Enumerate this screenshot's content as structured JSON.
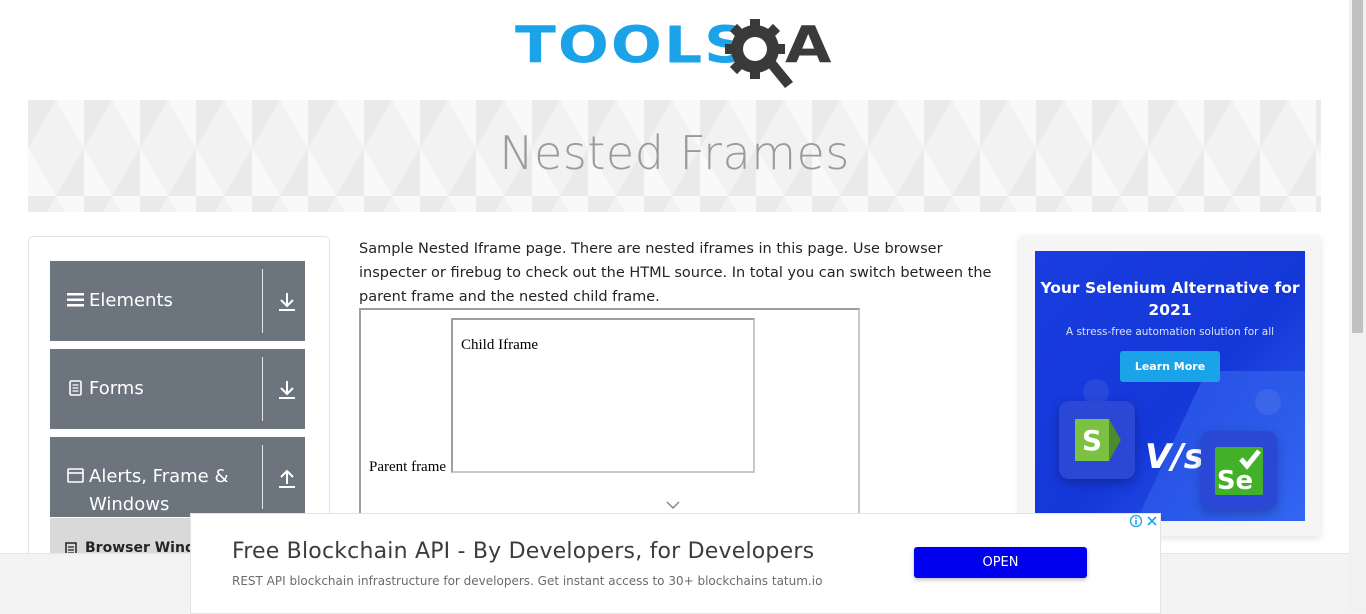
{
  "header": {
    "logo_tools": "TOOLS",
    "logo_a": "A",
    "logo_colors": {
      "tools": "#1aa3e8",
      "qa": "#3a3a3a"
    }
  },
  "banner": {
    "title": "Nested Frames"
  },
  "sidebar": {
    "groups": [
      {
        "label": "Elements",
        "icon": "hamburger-icon",
        "arrow": "download-arrow-icon"
      },
      {
        "label": "Forms",
        "icon": "document-icon",
        "arrow": "download-arrow-icon"
      },
      {
        "label": "Alerts, Frame & Windows",
        "icon": "window-icon",
        "arrow": "upload-arrow-icon"
      }
    ],
    "active_item": {
      "label": "Browser Windows"
    },
    "group_color": "#6c757d"
  },
  "main": {
    "description": "Sample Nested Iframe page. There are nested iframes in this page. Use browser inspecter or firebug to check out the HTML source. In total you can switch between the parent frame and the nested child frame.",
    "parent_frame_text": "Parent frame",
    "child_frame_text": "Child Iframe"
  },
  "side_ad": {
    "headline": "Your Selenium Alternative for 2021",
    "subtext": "A stress-free automation solution for all",
    "button_label": "Learn More",
    "vs_text": "V/s",
    "left_logo": "S",
    "right_logo": "Se",
    "colors": {
      "background": "#1437d8",
      "button": "#1aa3e8",
      "s_logo": "#7bc142",
      "se_logo": "#43b02a"
    }
  },
  "bottom_ad": {
    "title": "Free Blockchain API - By Developers, for Developers",
    "description": "REST API blockchain infrastructure for developers. Get instant access to 30+ blockchains tatum.io",
    "button_label": "OPEN",
    "button_color": "#0000ee"
  }
}
